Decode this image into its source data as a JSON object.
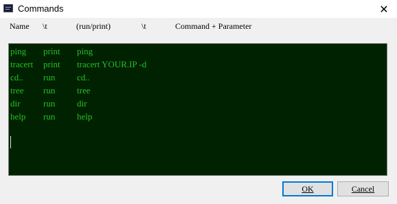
{
  "window": {
    "title": "Commands",
    "close_glyph": "✕"
  },
  "header": {
    "name": "Name",
    "tab1": "\\t",
    "mode": "(run/print)",
    "tab2": "\\t",
    "command": "Command + Parameter"
  },
  "commands": [
    {
      "name": "ping",
      "mode": "print",
      "command": "ping"
    },
    {
      "name": "tracert",
      "mode": "print",
      "command": "tracert YOUR.IP -d"
    },
    {
      "name": "cd..",
      "mode": "run",
      "command": "cd.."
    },
    {
      "name": "tree",
      "mode": "run",
      "command": "tree"
    },
    {
      "name": "dir",
      "mode": "run",
      "command": "dir"
    },
    {
      "name": "help",
      "mode": "run",
      "command": "help"
    }
  ],
  "buttons": {
    "ok_label": "OK",
    "cancel_label": "Cancel"
  },
  "colors": {
    "editor_bg": "#002200",
    "editor_text": "#27c027"
  }
}
